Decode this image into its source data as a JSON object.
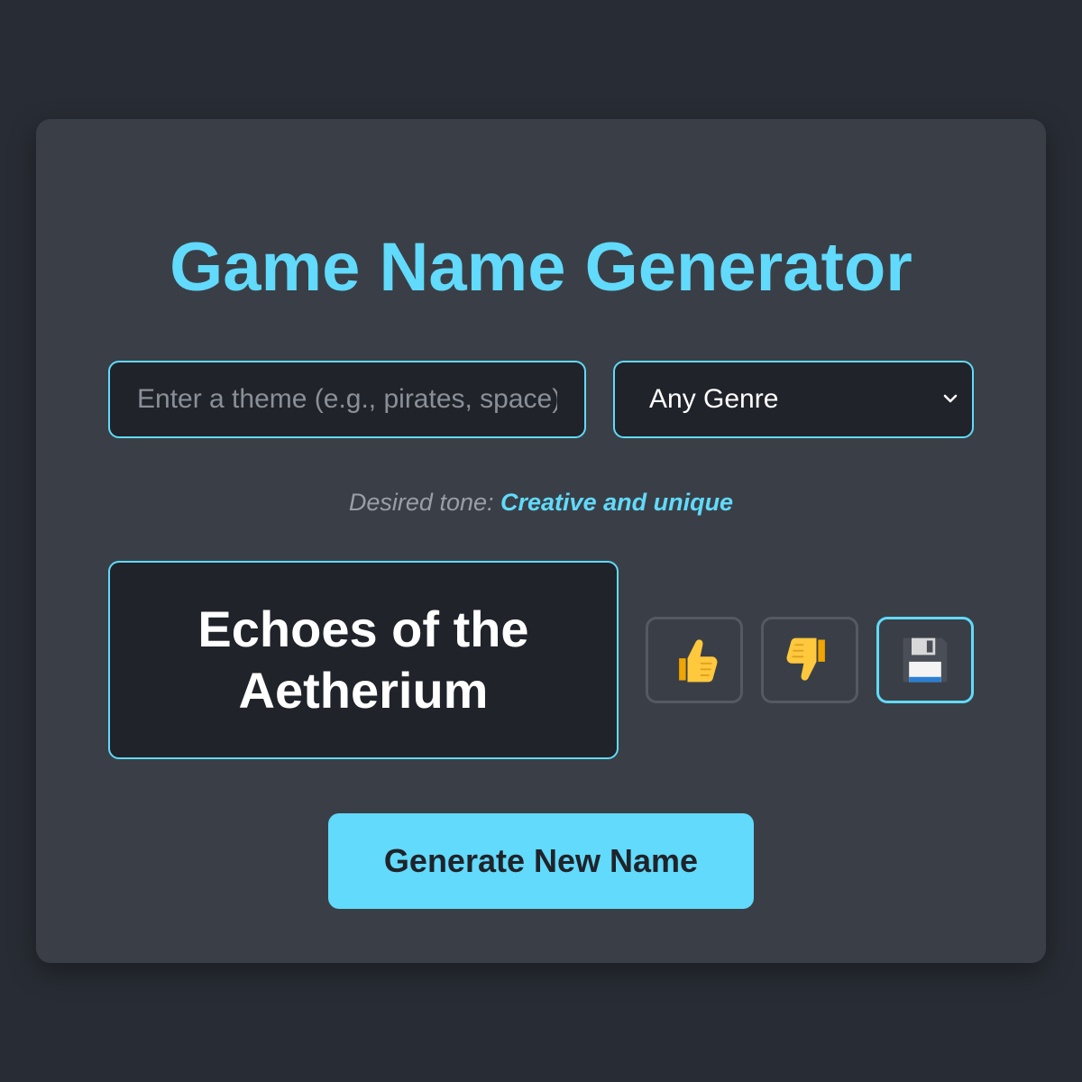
{
  "app": {
    "title": "Game Name Generator"
  },
  "controls": {
    "theme_placeholder": "Enter a theme (e.g., pirates, space)",
    "theme_value": "",
    "genre_selected": "Any Genre"
  },
  "tone": {
    "label": "Desired tone:",
    "value": "Creative and unique"
  },
  "result": {
    "name": "Echoes of the Aetherium"
  },
  "actions": {
    "like_icon": "thumbs-up-icon",
    "dislike_icon": "thumbs-down-icon",
    "save_icon": "floppy-disk-icon",
    "generate_label": "Generate New Name"
  },
  "colors": {
    "accent": "#61dafb",
    "background": "#282c34",
    "card": "#3a3f47",
    "field": "#20232a"
  }
}
